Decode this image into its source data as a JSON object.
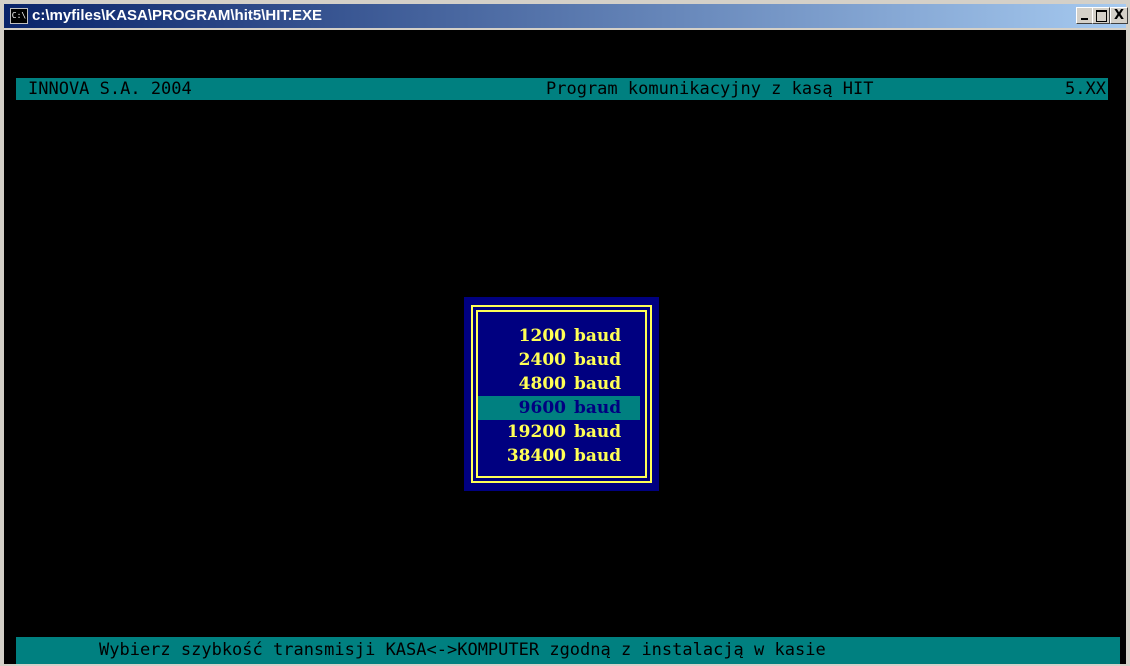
{
  "window": {
    "title": "c:\\myfiles\\KASA\\PROGRAM\\hit5\\HIT.EXE",
    "icon_text": "C:\\",
    "controls": {
      "minimize": "",
      "maximize": "",
      "close": "X"
    }
  },
  "header": {
    "left": "INNOVA S.A. 2004",
    "middle": "Program komunikacyjny z kasą HIT",
    "version": "5.XX"
  },
  "baud_menu": {
    "items": [
      {
        "value": "1200",
        "unit": "baud",
        "selected": false
      },
      {
        "value": "2400",
        "unit": "baud",
        "selected": false
      },
      {
        "value": "4800",
        "unit": "baud",
        "selected": false
      },
      {
        "value": "9600",
        "unit": "baud",
        "selected": true
      },
      {
        "value": "19200",
        "unit": "baud",
        "selected": false
      },
      {
        "value": "38400",
        "unit": "baud",
        "selected": false
      }
    ]
  },
  "status": {
    "text": "Wybierz szybkość transmisji KASA<->KOMPUTER zgodną z instalacją w kasie"
  },
  "colors": {
    "console_bg": "#000000",
    "bar_bg": "#008080",
    "dialog_bg": "#000080",
    "dialog_fg": "#ffff55"
  }
}
